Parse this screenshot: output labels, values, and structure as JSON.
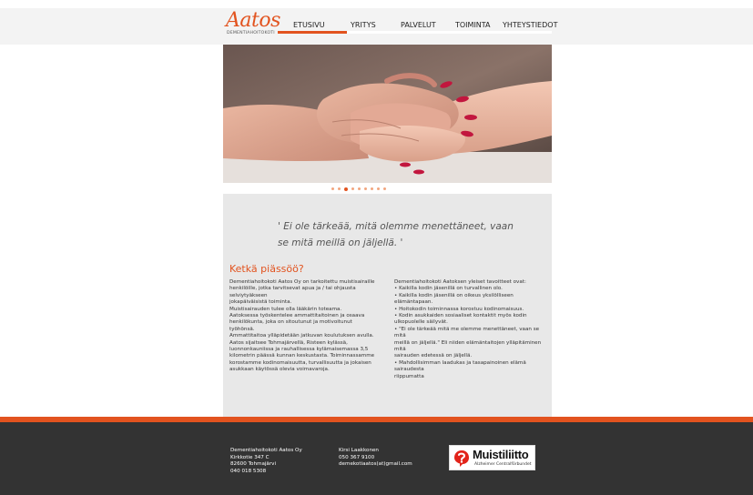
{
  "logo": {
    "script": "Aatos",
    "subtitle": "DEMENTIAHOITOKOTI"
  },
  "nav": {
    "items": [
      "ETUSIVU",
      "YRITYS",
      "PALVELUT",
      "TOIMINTA",
      "YHTEYSTIEDOT"
    ],
    "active_index": 0
  },
  "slider": {
    "dot_count": 9,
    "active_dot": 2
  },
  "quote": "' Ei ole tärkeää, mitä olemme menettäneet, vaan se mitä meillä on jäljellä. '",
  "section": {
    "title": "Ketkä piässöö?",
    "left_lines": [
      "Dementiahoitokoti Aatos Oy on tarkoitettu muistisairaille",
      "henkilöille, jotka tarvitsevat apua ja / tai ohjausta selviytyäkseen",
      "jokapäiväisistä toiminta.",
      "Muistisairauden tulee olla lääkärin toteama.",
      "Aatoksessa työskentelee ammattitaitoinen ja osaava",
      "henkilökunta, joka on sitoutunut ja motivoitunut työhönsä.",
      "Ammattitaitoa ylläpidetään jatkuvan koulutuksen avulla.",
      "Aatos sijaitsee Tohmajärvellä, Risteen kylässä,",
      "luonnonkauniissa ja rauhallisessa kylämaisemassa 3,5",
      "kilometrin päässä kunnan keskustasta. Toiminnassamme",
      "korostamme kodinomaisuutta, turvallisuutta ja jokaisen",
      "asukkaan käytössä olevia voimavaroja."
    ],
    "right_lines": [
      "Dementiahoitokoti Aatoksen yleiset tavoitteet ovat:",
      "• Kaikilla kodin jäsenillä on turvallinen olo.",
      "• Kaikilla kodin jäsenillä on oikeus yksilölliseen elämäntapaan.",
      "• Hoitokodin toiminnassa korostuu kodinomaisuus.",
      "• Kodin asukkaiden sosiaaliset kontaktit myös kodin",
      "ulkopuolelle säilyvät.",
      "• \"Ei ole tärkeää mitä me olemme menettäneet, vaan se mitä",
      "meillä on jäljellä.\" Eli niiden elämäntaitojen ylläpitäminen mitä",
      "sairauden edetessä on jäljellä.",
      "• Mahdollisimman laadukas ja tasapainoinen elämä sairaudesta",
      "riippumatta"
    ]
  },
  "footer": {
    "col1": [
      "Dementiahoitokoti Aatos Oy",
      "Kirkkotie 347 C",
      "82600 Tohmajärvi",
      "040 018 5308"
    ],
    "col2": [
      "Kirsi Laakkonen",
      "050 367 9100",
      "demekotiaatos(at)gmail.com"
    ],
    "partner": {
      "name": "Muistiliitto",
      "subtitle": "Alzheimer Centralförbundet"
    }
  },
  "colors": {
    "accent": "#e2531f",
    "footer_bg": "#333333",
    "content_bg": "#e8e8e8"
  }
}
